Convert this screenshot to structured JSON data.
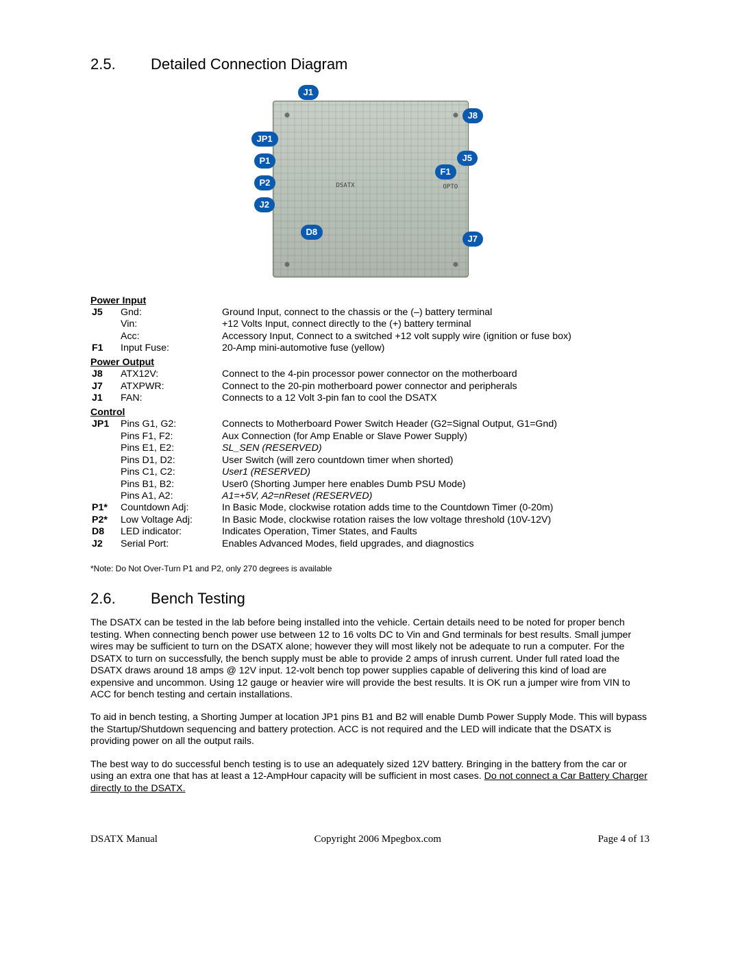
{
  "section25": {
    "num": "2.5.",
    "title": "Detailed Connection Diagram"
  },
  "section26": {
    "num": "2.6.",
    "title": "Bench Testing"
  },
  "callouts": {
    "J1": "J1",
    "J8": "J8",
    "JP1": "JP1",
    "J5": "J5",
    "P1": "P1",
    "F1": "F1",
    "P2": "P2",
    "J2": "J2",
    "D8": "D8",
    "J7": "J7"
  },
  "board_text": {
    "dsatx": "DSATX",
    "opto": "OPTO"
  },
  "labels": {
    "power_input": "Power Input",
    "power_output": "Power Output",
    "control": "Control"
  },
  "power_input": [
    {
      "ref": "J5",
      "pin": "Gnd:",
      "desc": "Ground Input, connect to the chassis or the (–) battery terminal"
    },
    {
      "ref": "",
      "pin": "Vin:",
      "desc": "+12 Volts Input, connect directly to the (+) battery terminal"
    },
    {
      "ref": "",
      "pin": "Acc:",
      "desc": "Accessory Input, Connect to a switched +12 volt supply wire (ignition or fuse box)"
    },
    {
      "ref": "F1",
      "pin": "Input Fuse:",
      "desc": "20-Amp mini-automotive fuse (yellow)"
    }
  ],
  "power_output": [
    {
      "ref": "J8",
      "pin": "ATX12V:",
      "desc": "Connect to the 4-pin processor power connector on the motherboard"
    },
    {
      "ref": "J7",
      "pin": "ATXPWR:",
      "desc": "Connect to the 20-pin motherboard power connector and peripherals"
    },
    {
      "ref": "J1",
      "pin": "FAN:",
      "desc": "Connects to a 12 Volt 3-pin fan to cool the DSATX"
    }
  ],
  "control": [
    {
      "ref": "JP1",
      "pin": "Pins G1, G2:",
      "desc": "Connects to Motherboard Power Switch Header (G2=Signal Output, G1=Gnd)",
      "ital": false
    },
    {
      "ref": "",
      "pin": "Pins F1, F2:",
      "desc": "Aux Connection (for Amp Enable or Slave Power Supply)",
      "ital": false
    },
    {
      "ref": "",
      "pin": "Pins E1, E2:",
      "desc": "SL_SEN (RESERVED)",
      "ital": true
    },
    {
      "ref": "",
      "pin": "Pins D1, D2:",
      "desc": "User Switch (will zero countdown timer when shorted)",
      "ital": false
    },
    {
      "ref": "",
      "pin": "Pins C1, C2:",
      "desc": "User1 (RESERVED)",
      "ital": true
    },
    {
      "ref": "",
      "pin": "Pins B1, B2:",
      "desc": "User0 (Shorting Jumper here enables Dumb PSU Mode)",
      "ital": false
    },
    {
      "ref": "",
      "pin": "Pins A1, A2:",
      "desc": "A1=+5V, A2=nReset (RESERVED)",
      "ital": true
    },
    {
      "ref": "P1*",
      "pin": "Countdown Adj:",
      "desc": "In Basic Mode, clockwise rotation adds time to the Countdown Timer (0-20m)",
      "ital": false
    },
    {
      "ref": "P2*",
      "pin": "Low Voltage Adj:",
      "desc": "In Basic Mode, clockwise rotation raises the low voltage threshold (10V-12V)",
      "ital": false
    },
    {
      "ref": "D8",
      "pin": "LED indicator:",
      "desc": "Indicates Operation, Timer States, and Faults",
      "ital": false
    },
    {
      "ref": "J2",
      "pin": "Serial Port:",
      "desc": "Enables Advanced Modes, field upgrades, and diagnostics",
      "ital": false
    }
  ],
  "note": "*Note: Do Not Over-Turn P1 and P2, only 270 degrees is available",
  "para1": "The DSATX can be tested in the lab before being installed into the vehicle. Certain details need to be noted for proper bench testing. When connecting bench power use between 12 to 16 volts DC to Vin and Gnd terminals for best results. Small jumper wires may be sufficient to turn on the DSATX alone; however they will most likely not be adequate to run a computer. For the DSATX to turn on successfully, the bench supply must be able to provide 2 amps of inrush current. Under full rated load the DSATX draws around 18 amps @ 12V input. 12-volt bench top power supplies capable of delivering this kind of load are expensive and uncommon.  Using 12 gauge or heavier wire will provide the best results. It is OK run a jumper wire from VIN to ACC for bench testing and certain installations.",
  "para2": "To aid in bench testing, a Shorting Jumper at location JP1 pins B1 and B2 will enable Dumb Power Supply Mode. This will bypass the Startup/Shutdown sequencing and battery protection. ACC is not required and the LED will indicate that the DSATX is providing power on all the output rails.",
  "para3a": "The best way to do successful bench testing is to use an adequately sized 12V battery. Bringing in the battery from the car or using an extra one that has at least a 12-AmpHour capacity will be sufficient in most cases. ",
  "para3b": "Do not connect a Car Battery Charger directly to the DSATX.",
  "footer": {
    "left": "DSATX Manual",
    "center": "Copyright 2006 Mpegbox.com",
    "right": "Page 4 of 13"
  }
}
